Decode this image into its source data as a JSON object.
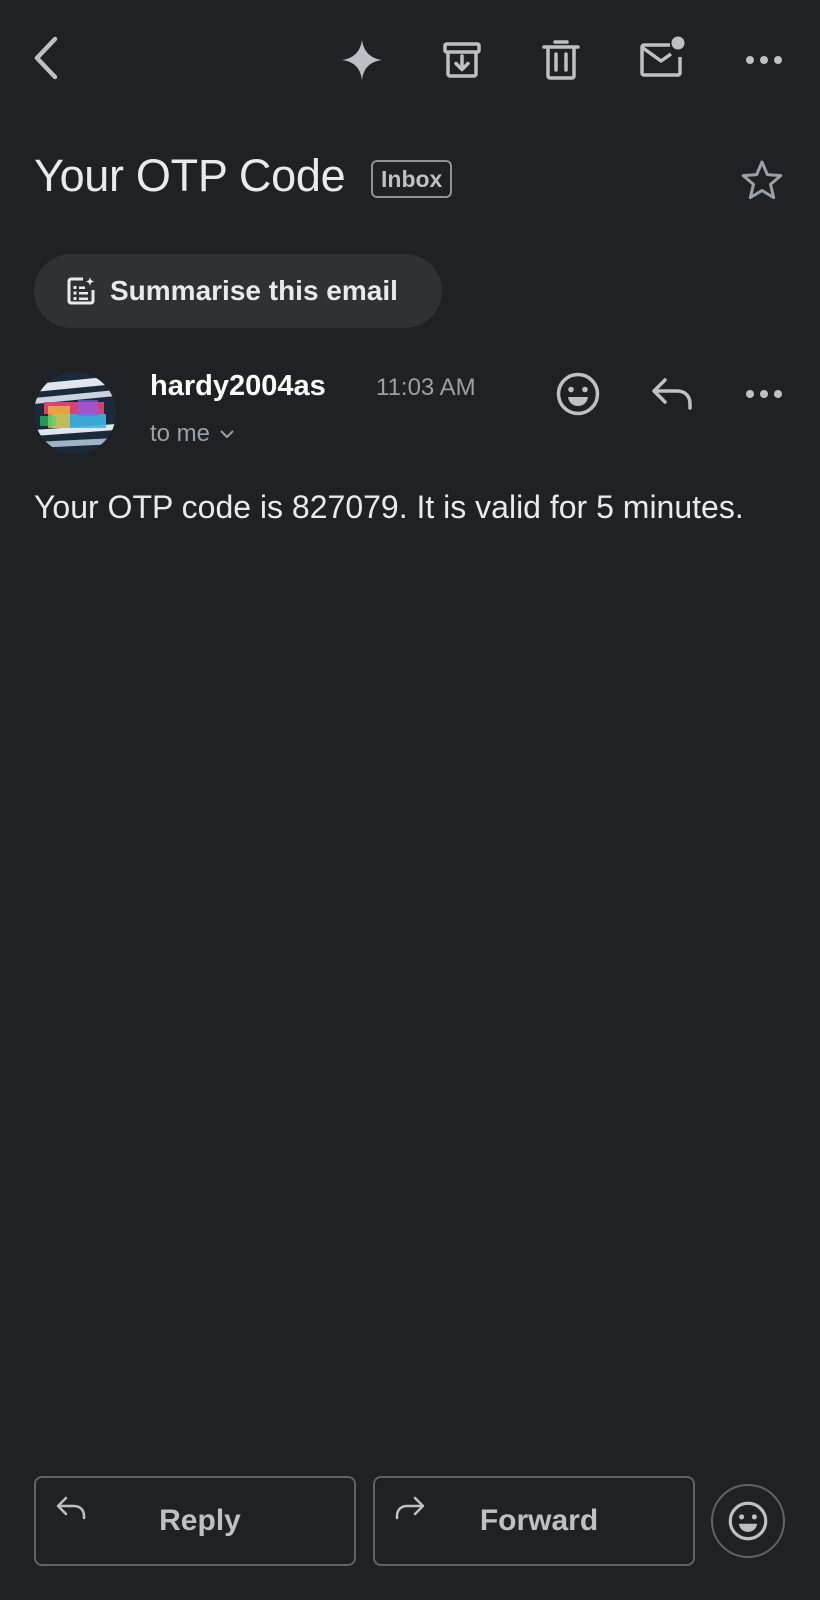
{
  "toolbar": {
    "back_icon": "chevron-left-icon",
    "gemini_icon": "sparkle-icon",
    "archive_icon": "archive-icon",
    "delete_icon": "trash-icon",
    "unread_icon": "mark-unread-icon",
    "more_icon": "more-horizontal-icon"
  },
  "email": {
    "subject": "Your OTP Code",
    "label": "Inbox",
    "starred": false,
    "summarise_label": "Summarise this email",
    "sender": {
      "name": "hardy2004as",
      "time": "11:03 AM",
      "recipients": "to me"
    },
    "body": "Your OTP code is 827079. It is valid for 5 minutes."
  },
  "actions": {
    "reply_label": "Reply",
    "forward_label": "Forward"
  },
  "colors": {
    "background": "#202124",
    "chip": "#303134",
    "text_primary": "#e8eaed",
    "text_secondary": "#9aa0a6",
    "border": "#5f6368"
  }
}
